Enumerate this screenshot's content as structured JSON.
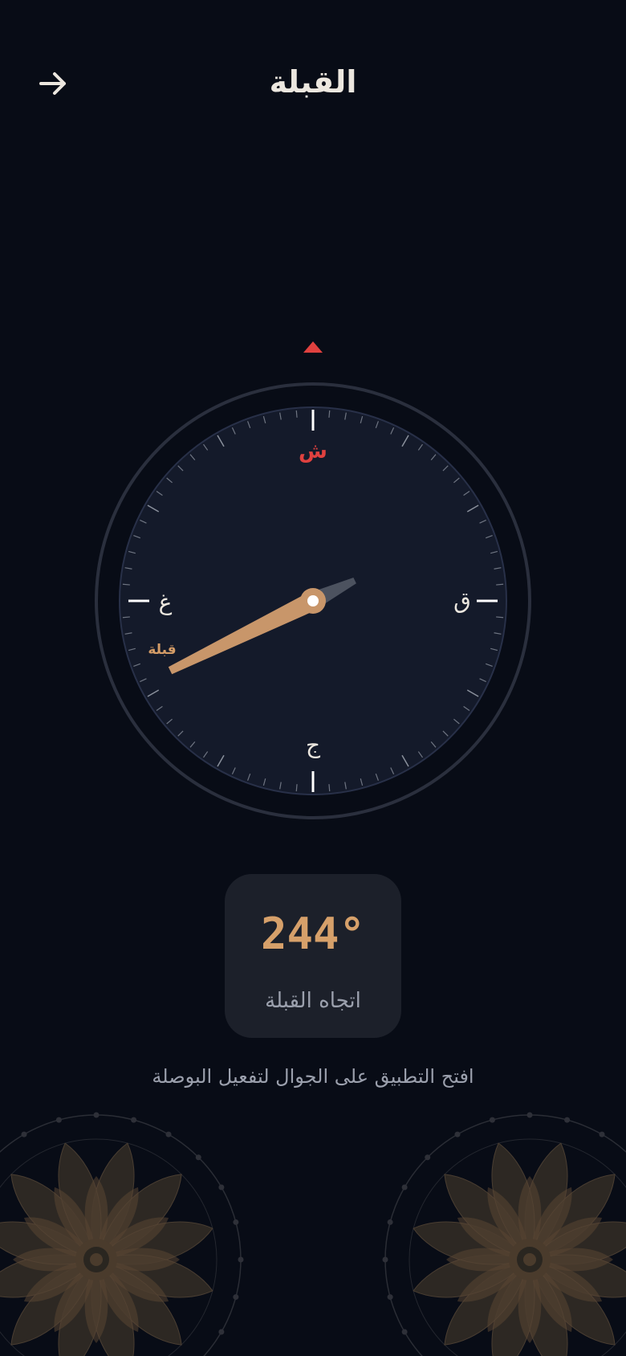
{
  "header": {
    "title": "القبلة",
    "back_icon": "arrow-right-icon"
  },
  "compass": {
    "pointer_icon": "triangle-up-icon",
    "north": "ش",
    "east": "ق",
    "south": "ج",
    "west": "غ",
    "qibla_marker": "قبلة",
    "needle_angle_deg": 244,
    "colors": {
      "north": "#e0413f",
      "needle": "#c8966a",
      "qibla_marker": "#d39b66",
      "dial": "#141a2a",
      "ring": "#2a2f3d"
    }
  },
  "info": {
    "angle": "244°",
    "label": "اتجاه القبلة"
  },
  "hint": "افتح التطبيق على الجوال لتفعيل البوصلة",
  "decor": {
    "left_icon": "mandala-ornament",
    "right_icon": "mandala-ornament"
  }
}
